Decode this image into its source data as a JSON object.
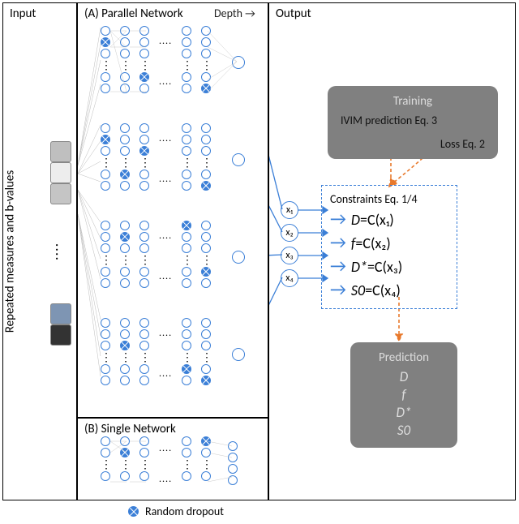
{
  "panels": {
    "input": "Input",
    "parallel": "(A) Parallel Network",
    "single": "(B) Single Network",
    "output": "Output",
    "depth": "Depth →"
  },
  "input_label": "Repeated measures and b-values",
  "output_nodes": [
    "x₁",
    "x₂",
    "x₃",
    "x₄"
  ],
  "constraints_title": "Constraints Eq. 1/4",
  "constraints": [
    {
      "lhs": "D",
      "rhs": "=C(x₁)"
    },
    {
      "lhs": "f",
      "rhs": "=C(x₂)"
    },
    {
      "lhs": "D*",
      "rhs": "=C(x₃)"
    },
    {
      "lhs": "S0",
      "rhs": "=C(x₄)"
    }
  ],
  "training": {
    "title": "Training",
    "pred": "IVIM prediction Eq. 3",
    "loss": "Loss Eq. 2"
  },
  "prediction": {
    "title": "Prediction",
    "items": [
      "D",
      "f",
      "D*",
      "S0"
    ]
  },
  "legend": "Random dropout",
  "input_colors": {
    "top": [
      "#BFBFBF",
      "#EDEDED",
      "#C5C5C5"
    ],
    "bottom": [
      "#7E95B3",
      "#333333"
    ]
  }
}
